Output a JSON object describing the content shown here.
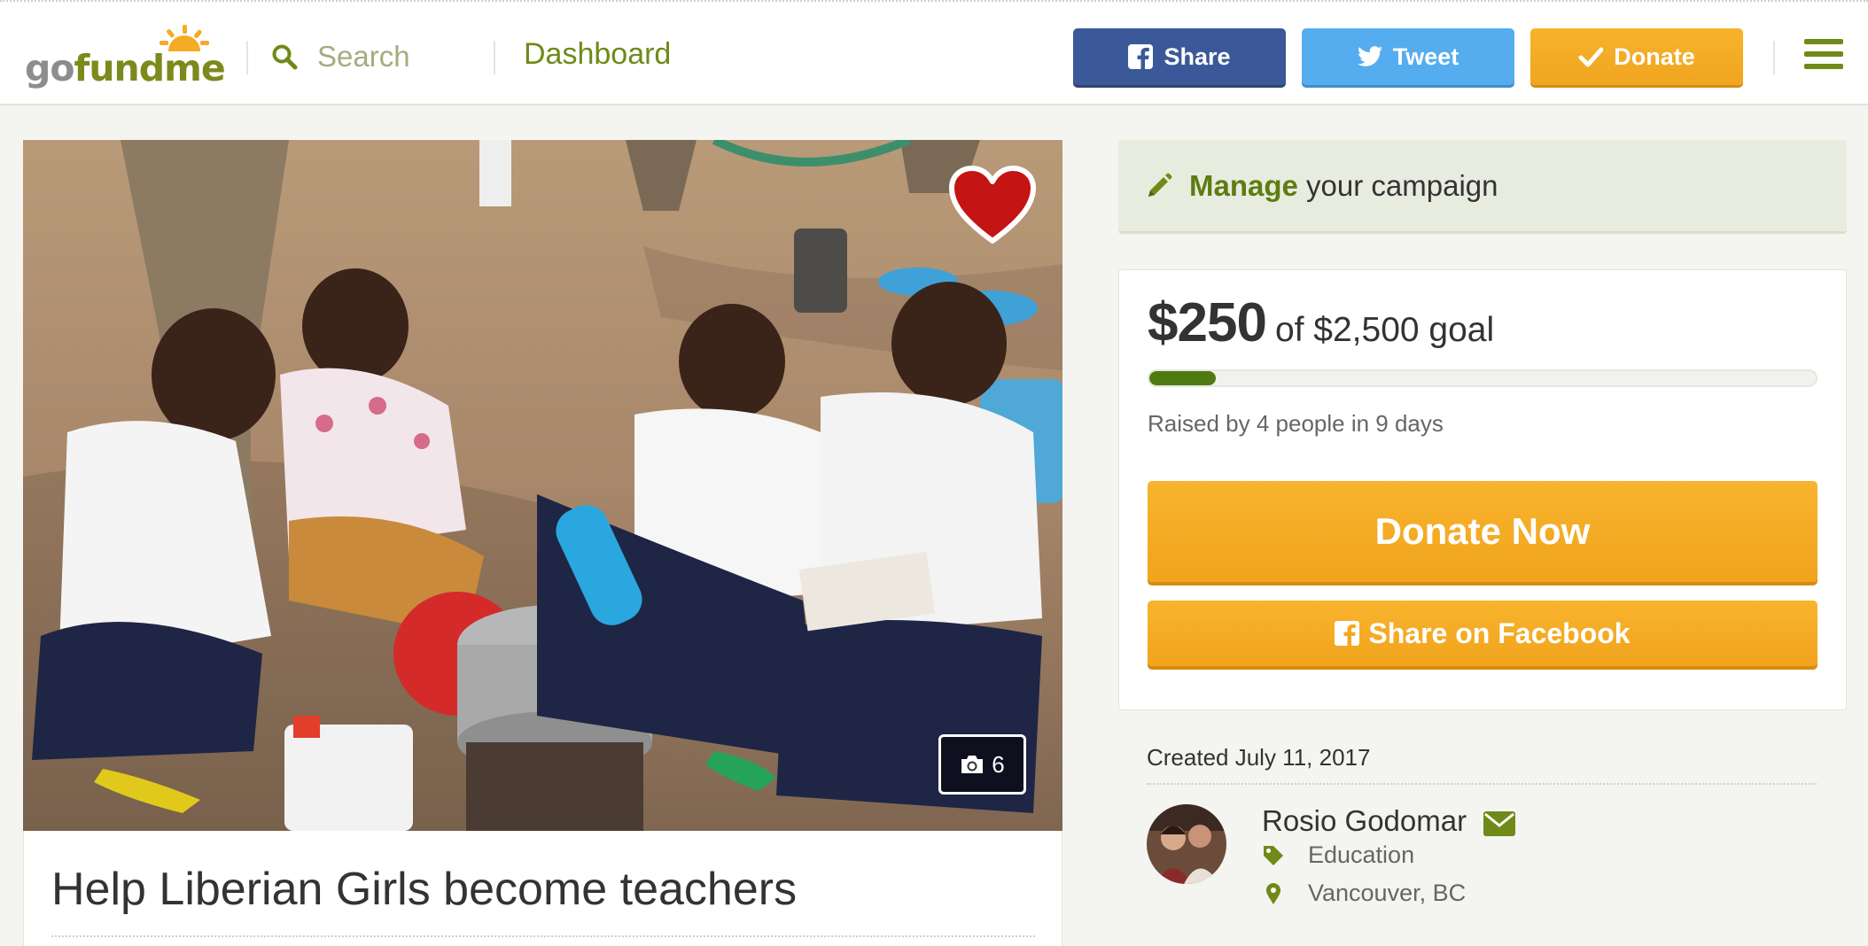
{
  "header": {
    "logo_text_go": "go",
    "logo_text_fund": "fund",
    "logo_text_me": "me",
    "search_placeholder": "Search",
    "dashboard_label": "Dashboard",
    "share_label": "Share",
    "tweet_label": "Tweet",
    "donate_label": "Donate",
    "icons": [
      "search-icon",
      "facebook-icon",
      "twitter-icon",
      "check-icon",
      "menu-icon"
    ]
  },
  "campaign": {
    "title": "Help Liberian Girls become teachers",
    "photo_count": "6"
  },
  "manage": {
    "strong": "Manage",
    "rest": " your campaign"
  },
  "donation": {
    "raised": "$250",
    "goal_text": "of $2,500 goal",
    "progress_fraction": 0.1,
    "raised_by": "Raised by 4 people in 9 days",
    "donate_now_label": "Donate Now",
    "share_facebook_label": "Share on Facebook"
  },
  "organizer": {
    "created": "Created July 11, 2017",
    "name": "Rosio Godomar",
    "category": "Education",
    "location": "Vancouver, BC"
  },
  "colors": {
    "brand_green": "#6f8a18",
    "facebook_blue": "#3b5998",
    "twitter_blue": "#55acee",
    "donate_orange": "#f5ab22",
    "progress_green": "#4f7a12"
  }
}
